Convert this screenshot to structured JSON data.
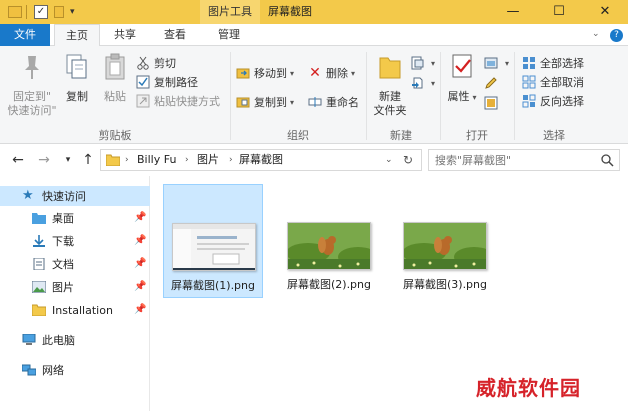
{
  "titlebar": {
    "tool_tab": "图片工具",
    "title": "屏幕截图",
    "minimize": "—",
    "maximize": "☐",
    "close": "✕"
  },
  "tabs": {
    "file": "文件",
    "home": "主页",
    "share": "共享",
    "view": "查看",
    "manage": "管理"
  },
  "ribbon": {
    "clipboard": {
      "label": "剪贴板",
      "pin_quick": "固定到\"\n快速访问\"",
      "copy": "复制",
      "paste": "粘贴",
      "cut": "剪切",
      "copy_path": "复制路径",
      "paste_shortcut": "粘贴快捷方式"
    },
    "organize": {
      "label": "组织",
      "move_to": "移动到",
      "copy_to": "复制到",
      "delete": "删除",
      "rename": "重命名"
    },
    "new": {
      "label": "新建",
      "new_folder": "新建\n文件夹"
    },
    "open": {
      "label": "打开",
      "properties": "属性"
    },
    "select": {
      "label": "选择",
      "select_all": "全部选择",
      "select_none": "全部取消",
      "invert": "反向选择"
    }
  },
  "address": {
    "crumbs": [
      "Billy Fu",
      "图片",
      "屏幕截图"
    ],
    "search_placeholder": "搜索\"屏幕截图\""
  },
  "navpane": {
    "quick_access": "快速访问",
    "items": [
      "桌面",
      "下载",
      "文档",
      "图片",
      "Installation"
    ],
    "this_pc": "此电脑",
    "network": "网络"
  },
  "files": [
    {
      "name": "屏幕截图(1).png"
    },
    {
      "name": "屏幕截图(2).png"
    },
    {
      "name": "屏幕截图(3).png"
    }
  ],
  "watermark": "威航软件园",
  "colors": {
    "titlebar": "#f3c94a",
    "file_tab": "#1979ca",
    "selection": "#cce8ff",
    "watermark": "#d6232a"
  }
}
